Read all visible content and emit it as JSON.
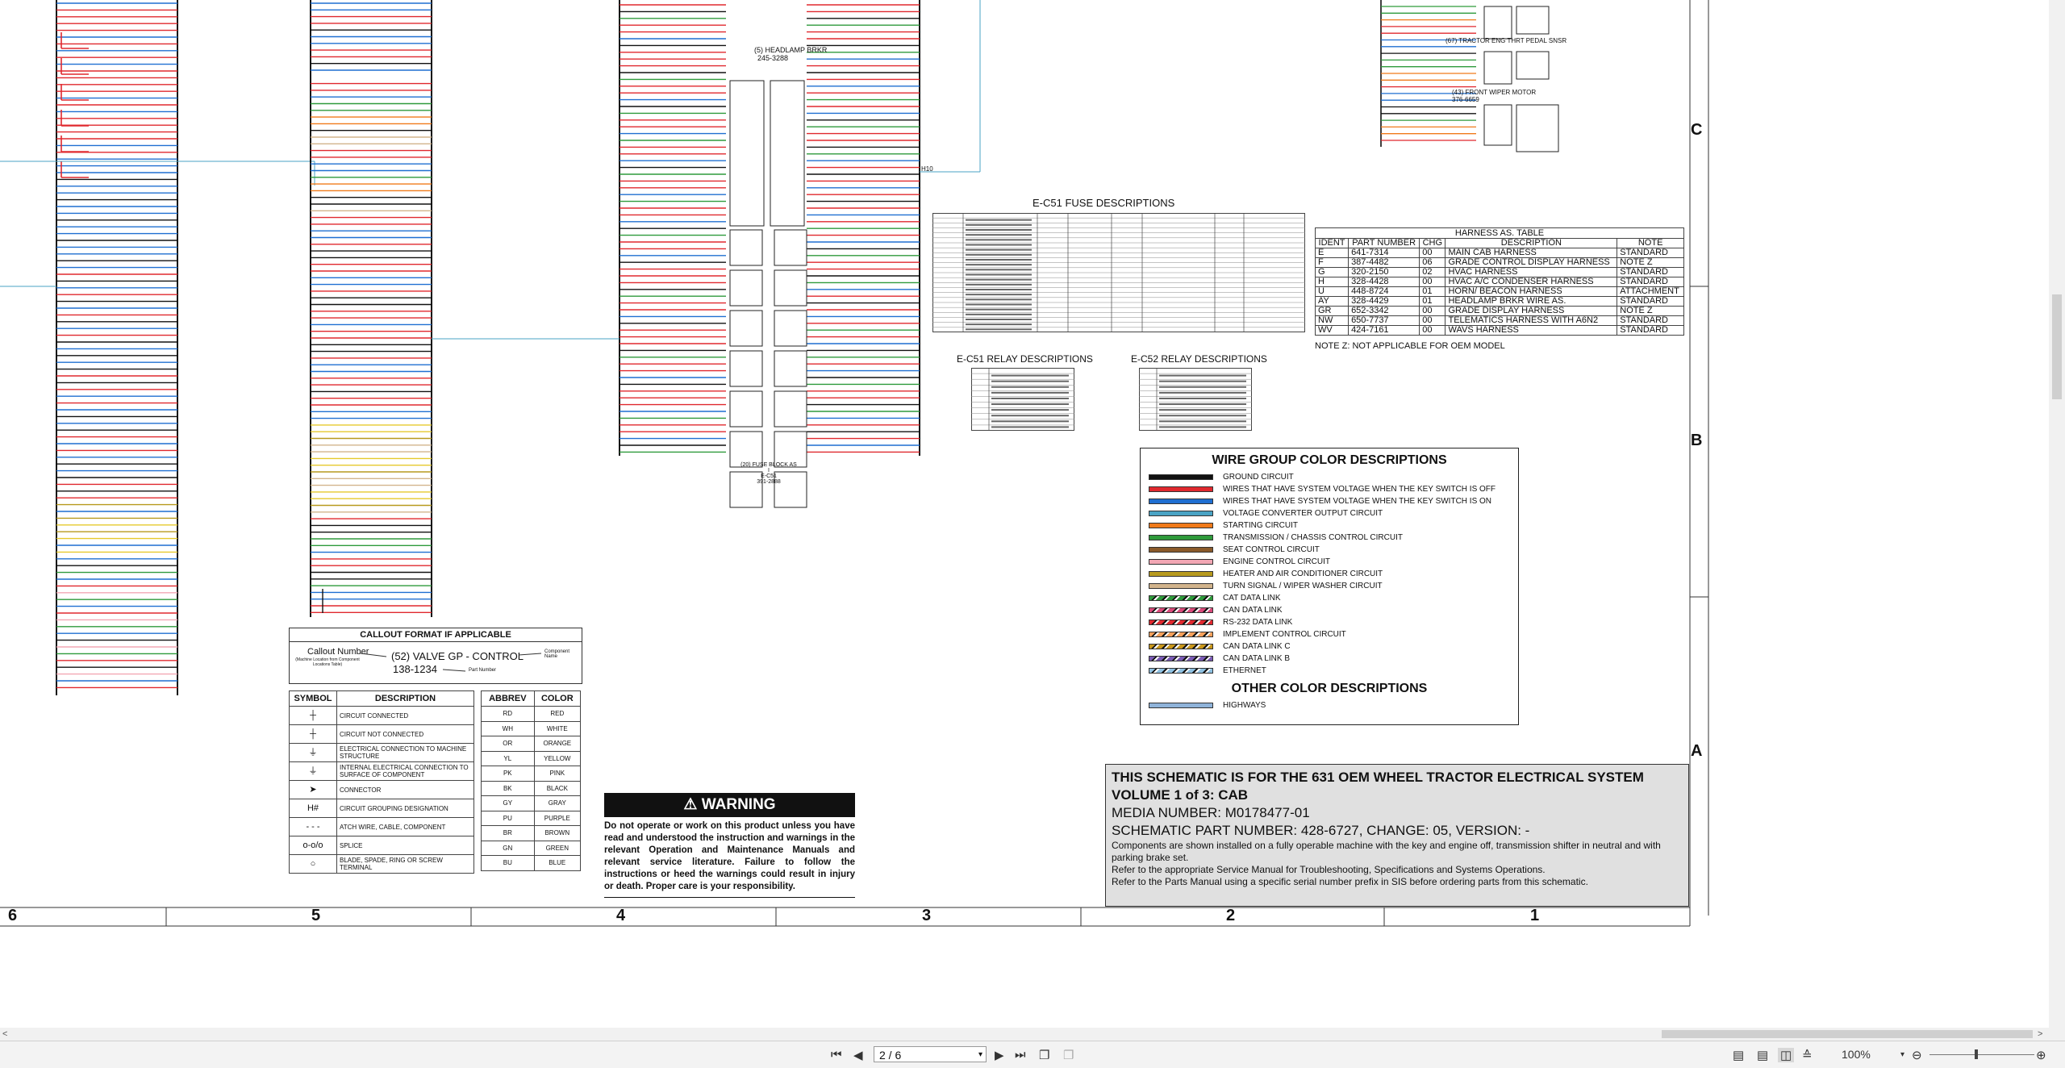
{
  "fuse_panel": {
    "title": "E-C51 FUSE DESCRIPTIONS",
    "columns": [
      "POSITION",
      "DESCRIPTION",
      "RATING",
      "PART NUMBER"
    ]
  },
  "relay_c51": {
    "title": "E-C51 RELAY DESCRIPTIONS"
  },
  "relay_c52": {
    "title": "E-C52 RELAY DESCRIPTIONS"
  },
  "harness_table": {
    "title": "HARNESS AS. TABLE",
    "columns": [
      "IDENT",
      "PART NUMBER",
      "CHG",
      "DESCRIPTION",
      "NOTE"
    ],
    "rows": [
      [
        "E",
        "641-7314",
        "00",
        "MAIN CAB HARNESS",
        "STANDARD"
      ],
      [
        "F",
        "387-4482",
        "06",
        "GRADE CONTROL DISPLAY HARNESS",
        "NOTE Z"
      ],
      [
        "G",
        "320-2150",
        "02",
        "HVAC HARNESS",
        "STANDARD"
      ],
      [
        "H",
        "328-4428",
        "00",
        "HVAC A/C CONDENSER HARNESS",
        "STANDARD"
      ],
      [
        "U",
        "448-8724",
        "01",
        "HORN/ BEACON HARNESS",
        "ATTACHMENT"
      ],
      [
        "AY",
        "328-4429",
        "01",
        "HEADLAMP BRKR WIRE AS.",
        "STANDARD"
      ],
      [
        "GR",
        "652-3342",
        "00",
        "GRADE DISPLAY HARNESS",
        "NOTE Z"
      ],
      [
        "NW",
        "650-7737",
        "00",
        "TELEMATICS HARNESS WITH A6N2",
        "STANDARD"
      ],
      [
        "WV",
        "424-7161",
        "00",
        "WAVS HARNESS",
        "STANDARD"
      ]
    ],
    "note": "NOTE Z: NOT APPLICABLE FOR OEM MODEL"
  },
  "wire_group": {
    "title": "WIRE GROUP COLOR DESCRIPTIONS",
    "items": [
      {
        "label": "GROUND CIRCUIT",
        "color": "#111111"
      },
      {
        "label": "WIRES THAT HAVE SYSTEM VOLTAGE WHEN THE KEY SWITCH IS OFF",
        "color": "#e0282e"
      },
      {
        "label": "WIRES THAT HAVE SYSTEM VOLTAGE WHEN THE KEY SWITCH IS ON",
        "color": "#1f6fd1"
      },
      {
        "label": "VOLTAGE CONVERTER OUTPUT CIRCUIT",
        "color": "#4aa3c4"
      },
      {
        "label": "STARTING CIRCUIT",
        "color": "#f07a1a"
      },
      {
        "label": "TRANSMISSION / CHASSIS CONTROL CIRCUIT",
        "color": "#2e9a3b"
      },
      {
        "label": "SEAT CONTROL CIRCUIT",
        "color": "#8a5a2b"
      },
      {
        "label": "ENGINE CONTROL CIRCUIT",
        "color": "#f2a7b4"
      },
      {
        "label": "HEATER AND AIR CONDITIONER CIRCUIT",
        "color": "#b79a1e"
      },
      {
        "label": "TURN SIGNAL / WIPER WASHER CIRCUIT",
        "color": "#d2b48c"
      },
      {
        "label": "CAT DATA LINK",
        "color": "#2e9a3b"
      },
      {
        "label": "CAN DATA LINK",
        "color": "#d94a7a"
      },
      {
        "label": "RS-232 DATA LINK",
        "color": "#e0282e"
      },
      {
        "label": "IMPLEMENT CONTROL CIRCUIT",
        "color": "#f5a05a"
      },
      {
        "label": "CAN DATA LINK C",
        "color": "#c8961a"
      },
      {
        "label": "CAN DATA LINK B",
        "color": "#7a5bb5"
      },
      {
        "label": "ETHERNET",
        "color": "#8ec0e0"
      }
    ],
    "other_title": "OTHER COLOR DESCRIPTIONS",
    "other_items": [
      {
        "label": "HIGHWAYS",
        "color": "#8fb3d9"
      }
    ]
  },
  "callout": {
    "title": "CALLOUT FORMAT IF APPLICABLE",
    "callout_number": "Callout Number",
    "callout_sub": "(Machine Location from Component Locations Table)",
    "example": "(52) VALVE GP - CONTROL",
    "component_name": "Component Name",
    "part_example": "138-1234",
    "part_number": "Part Number"
  },
  "symbols": {
    "columns": [
      "SYMBOL",
      "DESCRIPTION"
    ],
    "rows": [
      {
        "symbol": "┼",
        "desc": "CIRCUIT CONNECTED"
      },
      {
        "symbol": "┼",
        "desc": "CIRCUIT NOT CONNECTED"
      },
      {
        "symbol": "⏚",
        "desc": "ELECTRICAL CONNECTION TO MACHINE STRUCTURE"
      },
      {
        "symbol": "⏚",
        "desc": "INTERNAL ELECTRICAL CONNECTION TO SURFACE OF COMPONENT"
      },
      {
        "symbol": "➤",
        "desc": "CONNECTOR"
      },
      {
        "symbol": "H#",
        "desc": "CIRCUIT GROUPING DESIGNATION"
      },
      {
        "symbol": "- - -",
        "desc": "ATCH WIRE, CABLE, COMPONENT"
      },
      {
        "symbol": "o-o/o",
        "desc": "SPLICE"
      },
      {
        "symbol": "○",
        "desc": "BLADE, SPADE, RING OR SCREW TERMINAL"
      }
    ]
  },
  "abbrev": {
    "columns": [
      "ABBREV",
      "COLOR"
    ],
    "rows": [
      [
        "RD",
        "RED"
      ],
      [
        "WH",
        "WHITE"
      ],
      [
        "OR",
        "ORANGE"
      ],
      [
        "YL",
        "YELLOW"
      ],
      [
        "PK",
        "PINK"
      ],
      [
        "BK",
        "BLACK"
      ],
      [
        "GY",
        "GRAY"
      ],
      [
        "PU",
        "PURPLE"
      ],
      [
        "BR",
        "BROWN"
      ],
      [
        "GN",
        "GREEN"
      ],
      [
        "BU",
        "BLUE"
      ]
    ]
  },
  "warning": {
    "title": "WARNING",
    "body": "Do not operate or work on this product unless you have read and understood the instruction and warnings in the relevant Operation and Maintenance Manuals and relevant service literature. Failure to follow the instructions or heed the warnings could result in injury or death. Proper care is your responsibility."
  },
  "title_block": {
    "line1": "THIS SCHEMATIC IS FOR THE 631 OEM WHEEL TRACTOR ELECTRICAL SYSTEM",
    "line2": "VOLUME 1 of 3: CAB",
    "media": "MEDIA NUMBER: M0178477-01",
    "part": "SCHEMATIC PART NUMBER: 428-6727, CHANGE: 05, VERSION: -",
    "note1": "Components are shown installed on a fully operable machine with the key and engine off, transmission shifter in neutral and with parking brake set.",
    "note2": "Refer to the appropriate Service Manual for Troubleshooting, Specifications and Systems Operations.",
    "note3": "Refer to the Parts Manual using a specific serial number prefix in SIS before ordering parts from this schematic."
  },
  "zones": {
    "columns": [
      "6",
      "5",
      "4",
      "3",
      "2",
      "1"
    ],
    "rows": [
      "C",
      "B",
      "A"
    ]
  },
  "schematic_labels": {
    "headlamp_brkr": "(5) HEADLAMP BRKR",
    "headlamp_pn": "245-3288",
    "fuse_block": "(20) FUSE BLOCK AS I",
    "fuse_block_id": "E-C51",
    "fuse_block_pn": "391-2888",
    "tractor_sensor": "(67) TRACTOR ENG THRT PEDAL SNSR",
    "wiper_motor": "(43) FRONT WIPER MOTOR",
    "wiper_pn": "376-6659",
    "h10": "H10"
  },
  "toolbar": {
    "page_value": "2 / 6",
    "zoom": "100%"
  }
}
